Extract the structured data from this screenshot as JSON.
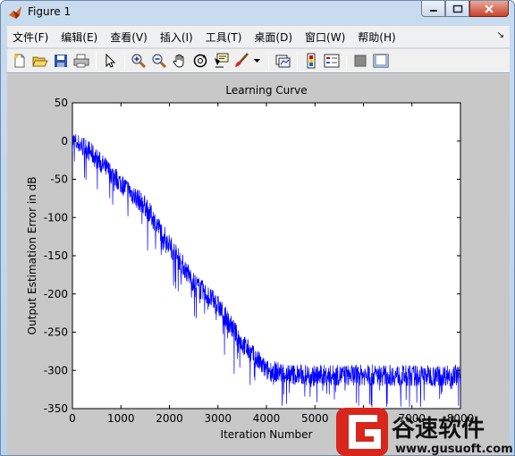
{
  "window": {
    "title": "Figure 1"
  },
  "menu": {
    "items": [
      "文件(F)",
      "编辑(E)",
      "查看(V)",
      "插入(I)",
      "工具(T)",
      "桌面(D)",
      "窗口(W)",
      "帮助(H)"
    ]
  },
  "toolbar": {
    "icons": [
      "new-figure-icon",
      "open-file-icon",
      "save-icon",
      "print-icon",
      "arrow-select-icon",
      "zoom-in-icon",
      "zoom-out-icon",
      "pan-hand-icon",
      "rotate-3d-icon",
      "data-cursor-icon",
      "brush-icon",
      "dropdown-icon",
      "link-plot-icon",
      "colorbar-icon",
      "legend-icon",
      "hide-plot-tools-icon",
      "show-plot-tools-icon"
    ]
  },
  "colors": {
    "series": "#0000ff",
    "figure_bg": "#c8c8c8"
  },
  "watermark": {
    "name": "谷速软件",
    "url": "www.gusuoft.com"
  },
  "chart_data": {
    "type": "line",
    "title": "Learning Curve",
    "xlabel": "Iteration Number",
    "ylabel": "Output Estimation Error in dB",
    "xlim": [
      0,
      8000
    ],
    "ylim": [
      -350,
      50
    ],
    "xticks": [
      0,
      1000,
      2000,
      3000,
      4000,
      5000,
      6000,
      7000,
      8000
    ],
    "yticks": [
      50,
      0,
      -50,
      -100,
      -150,
      -200,
      -250,
      -300,
      -350
    ],
    "grid": false,
    "series": [
      {
        "x": [
          0,
          300,
          600,
          1000,
          1500,
          2000,
          2500,
          3000,
          3500,
          4000,
          4500,
          5000,
          6000,
          7000,
          8000
        ],
        "y": [
          0,
          -10,
          -30,
          -55,
          -85,
          -135,
          -185,
          -215,
          -265,
          -300,
          -305,
          -307,
          -306,
          -307,
          -306
        ]
      }
    ]
  }
}
